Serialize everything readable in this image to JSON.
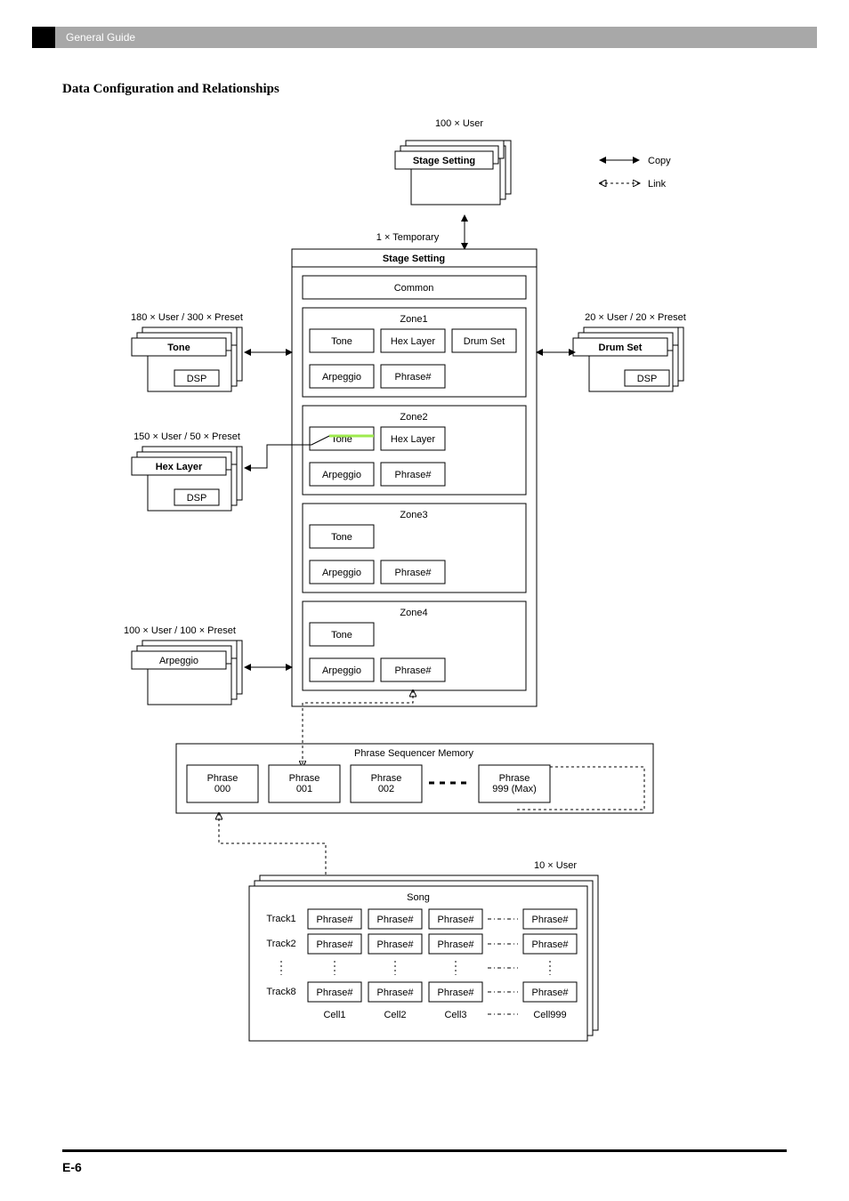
{
  "header": {
    "section": "General Guide"
  },
  "title": "Data Configuration and Relationships",
  "legend": {
    "copy": "Copy",
    "link": "Link"
  },
  "top": {
    "userCount": "100 × User",
    "stageSetting": "Stage Setting"
  },
  "temp": {
    "count": "1 × Temporary",
    "stageSetting": "Stage Setting",
    "common": "Common"
  },
  "zone1": {
    "name": "Zone1",
    "tone": "Tone",
    "hex": "Hex Layer",
    "drum": "Drum Set",
    "arp": "Arpeggio",
    "phrase": "Phrase#"
  },
  "zone2": {
    "name": "Zone2",
    "tone": "Tone",
    "hex": "Hex Layer",
    "arp": "Arpeggio",
    "phrase": "Phrase#"
  },
  "zone3": {
    "name": "Zone3",
    "tone": "Tone",
    "arp": "Arpeggio",
    "phrase": "Phrase#"
  },
  "zone4": {
    "name": "Zone4",
    "tone": "Tone",
    "arp": "Arpeggio",
    "phrase": "Phrase#"
  },
  "left": {
    "tone": {
      "count": "180 × User / 300 × Preset",
      "title": "Tone",
      "dsp": "DSP"
    },
    "hex": {
      "count": "150 × User / 50 × Preset",
      "title": "Hex Layer",
      "dsp": "DSP"
    },
    "arp": {
      "count": "100 × User / 100 × Preset",
      "title": "Arpeggio"
    }
  },
  "right": {
    "drum": {
      "count": "20 × User / 20 × Preset",
      "title": "Drum Set",
      "dsp": "DSP"
    }
  },
  "psm": {
    "title": "Phrase Sequencer Memory",
    "p0": "Phrase\n000",
    "p1": "Phrase\n001",
    "p2": "Phrase\n002",
    "pmax": "Phrase\n999 (Max)"
  },
  "song": {
    "count": "10 × User",
    "title": "Song",
    "track1": "Track1",
    "track2": "Track2",
    "track8": "Track8",
    "phrase": "Phrase#",
    "cell1": "Cell1",
    "cell2": "Cell2",
    "cell3": "Cell3",
    "cell999": "Cell999"
  },
  "pageNum": "E-6"
}
